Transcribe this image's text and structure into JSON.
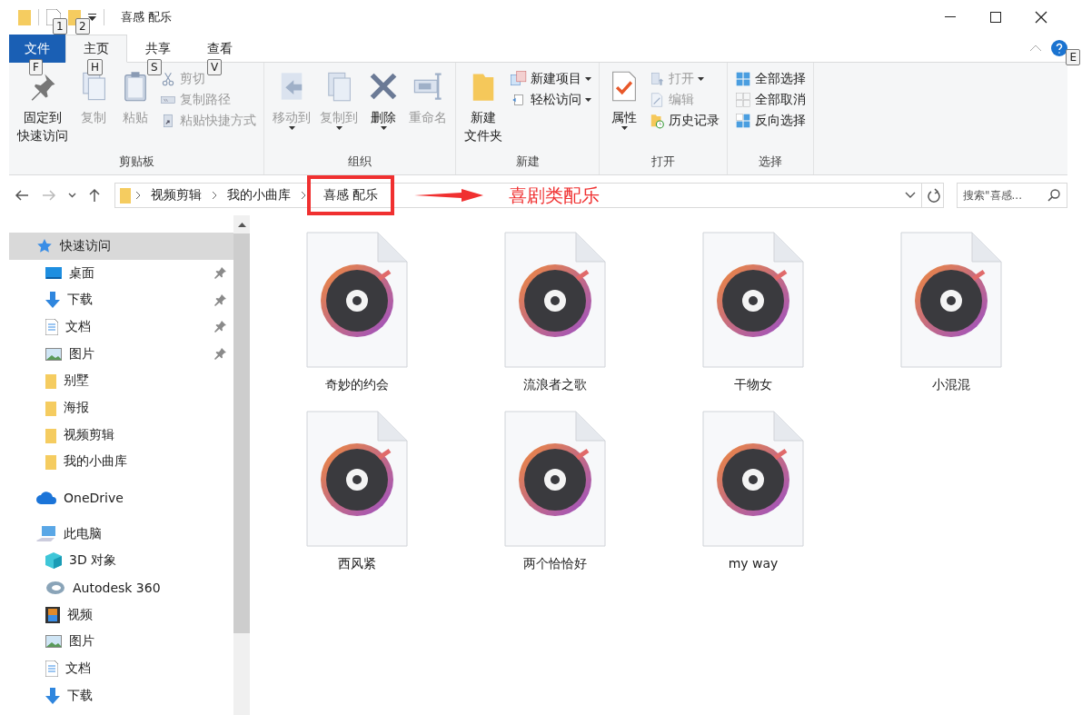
{
  "window": {
    "title": "喜感 配乐",
    "quick_access_key_tips": [
      "1",
      "2"
    ]
  },
  "ribbon": {
    "tabs": [
      {
        "label": "文件",
        "kind": "file",
        "selected": false,
        "key_tip": "F"
      },
      {
        "label": "主页",
        "kind": "tab",
        "selected": true,
        "key_tip": "H"
      },
      {
        "label": "共享",
        "kind": "tab",
        "selected": false,
        "key_tip": "S"
      },
      {
        "label": "查看",
        "kind": "tab",
        "selected": false,
        "key_tip": "V"
      }
    ],
    "help_key_tip": "E",
    "groups": [
      {
        "label": "剪贴板",
        "items": [
          {
            "label_lines": [
              "固定到",
              "快速访问"
            ],
            "kind": "large",
            "disabled": false,
            "has_menu": false
          },
          {
            "label": "复制",
            "kind": "large",
            "disabled": true,
            "has_menu": false
          },
          {
            "label": "粘贴",
            "kind": "large",
            "disabled": true,
            "has_menu": false
          },
          {
            "label": "剪切",
            "kind": "small",
            "disabled": true,
            "has_menu": false
          },
          {
            "label": "复制路径",
            "kind": "small",
            "disabled": true,
            "has_menu": false
          },
          {
            "label": "粘贴快捷方式",
            "kind": "small",
            "disabled": true,
            "has_menu": false
          }
        ]
      },
      {
        "label": "组织",
        "items": [
          {
            "label": "移动到",
            "kind": "large",
            "disabled": true,
            "has_menu": true
          },
          {
            "label": "复制到",
            "kind": "large",
            "disabled": true,
            "has_menu": true
          },
          {
            "label": "删除",
            "kind": "large",
            "disabled": false,
            "has_menu": true
          },
          {
            "label": "重命名",
            "kind": "large",
            "disabled": true,
            "has_menu": false
          }
        ]
      },
      {
        "label": "新建",
        "items": [
          {
            "label_lines": [
              "新建",
              "文件夹"
            ],
            "kind": "large",
            "disabled": false,
            "has_menu": false
          },
          {
            "label": "新建项目",
            "kind": "small",
            "disabled": false,
            "has_menu": true
          },
          {
            "label": "轻松访问",
            "kind": "small",
            "disabled": false,
            "has_menu": true
          }
        ]
      },
      {
        "label": "打开",
        "items": [
          {
            "label": "属性",
            "kind": "large",
            "disabled": false,
            "has_menu": true
          },
          {
            "label": "打开",
            "kind": "small",
            "disabled": true,
            "has_menu": true
          },
          {
            "label": "编辑",
            "kind": "small",
            "disabled": true,
            "has_menu": false
          },
          {
            "label": "历史记录",
            "kind": "small",
            "disabled": false,
            "has_menu": false
          }
        ]
      },
      {
        "label": "选择",
        "items": [
          {
            "label": "全部选择",
            "kind": "small",
            "disabled": false,
            "has_menu": false
          },
          {
            "label": "全部取消",
            "kind": "small",
            "disabled": false,
            "has_menu": false
          },
          {
            "label": "反向选择",
            "kind": "small",
            "disabled": false,
            "has_menu": false
          }
        ]
      }
    ]
  },
  "navigation": {
    "back_disabled": false,
    "forward_disabled": true
  },
  "address_bar": {
    "crumbs": [
      {
        "label": "视频剪辑",
        "highlighted": false
      },
      {
        "label": "我的小曲库",
        "highlighted": false
      },
      {
        "label": "喜感 配乐",
        "highlighted": true
      }
    ]
  },
  "annotation": {
    "text": "喜剧类配乐"
  },
  "search": {
    "placeholder": "搜索\"喜感..."
  },
  "sidebar": {
    "items": [
      {
        "label": "快速访问",
        "kind": "star",
        "selected": true,
        "children": [
          {
            "label": "桌面",
            "kind": "desktop",
            "selected": false,
            "pinned": true
          },
          {
            "label": "下载",
            "kind": "download",
            "selected": false,
            "pinned": true
          },
          {
            "label": "文档",
            "kind": "document",
            "selected": false,
            "pinned": true
          },
          {
            "label": "图片",
            "kind": "pictures",
            "selected": false,
            "pinned": true
          },
          {
            "label": "别墅",
            "kind": "folder",
            "selected": false,
            "pinned": false
          },
          {
            "label": "海报",
            "kind": "folder",
            "selected": false,
            "pinned": false
          },
          {
            "label": "视频剪辑",
            "kind": "folder",
            "selected": false,
            "pinned": false
          },
          {
            "label": "我的小曲库",
            "kind": "folder",
            "selected": false,
            "pinned": false
          }
        ]
      },
      {
        "label": "OneDrive",
        "kind": "cloud",
        "selected": false
      },
      {
        "label": "此电脑",
        "kind": "computer",
        "selected": false,
        "children": [
          {
            "label": "3D 对象",
            "kind": "cube",
            "selected": false,
            "pinned": false
          },
          {
            "label": "Autodesk 360",
            "kind": "autodesk",
            "selected": false,
            "pinned": false
          },
          {
            "label": "视频",
            "kind": "video",
            "selected": false,
            "pinned": false
          },
          {
            "label": "图片",
            "kind": "pictures",
            "selected": false,
            "pinned": false
          },
          {
            "label": "文档",
            "kind": "document",
            "selected": false,
            "pinned": false
          },
          {
            "label": "下载",
            "kind": "download",
            "selected": false,
            "pinned": false
          }
        ]
      }
    ]
  },
  "files": [
    {
      "name": "奇妙的约会"
    },
    {
      "name": "流浪者之歌"
    },
    {
      "name": "干物女"
    },
    {
      "name": "小混混"
    },
    {
      "name": "西风紧"
    },
    {
      "name": "两个恰恰好"
    },
    {
      "name": "my way"
    }
  ]
}
